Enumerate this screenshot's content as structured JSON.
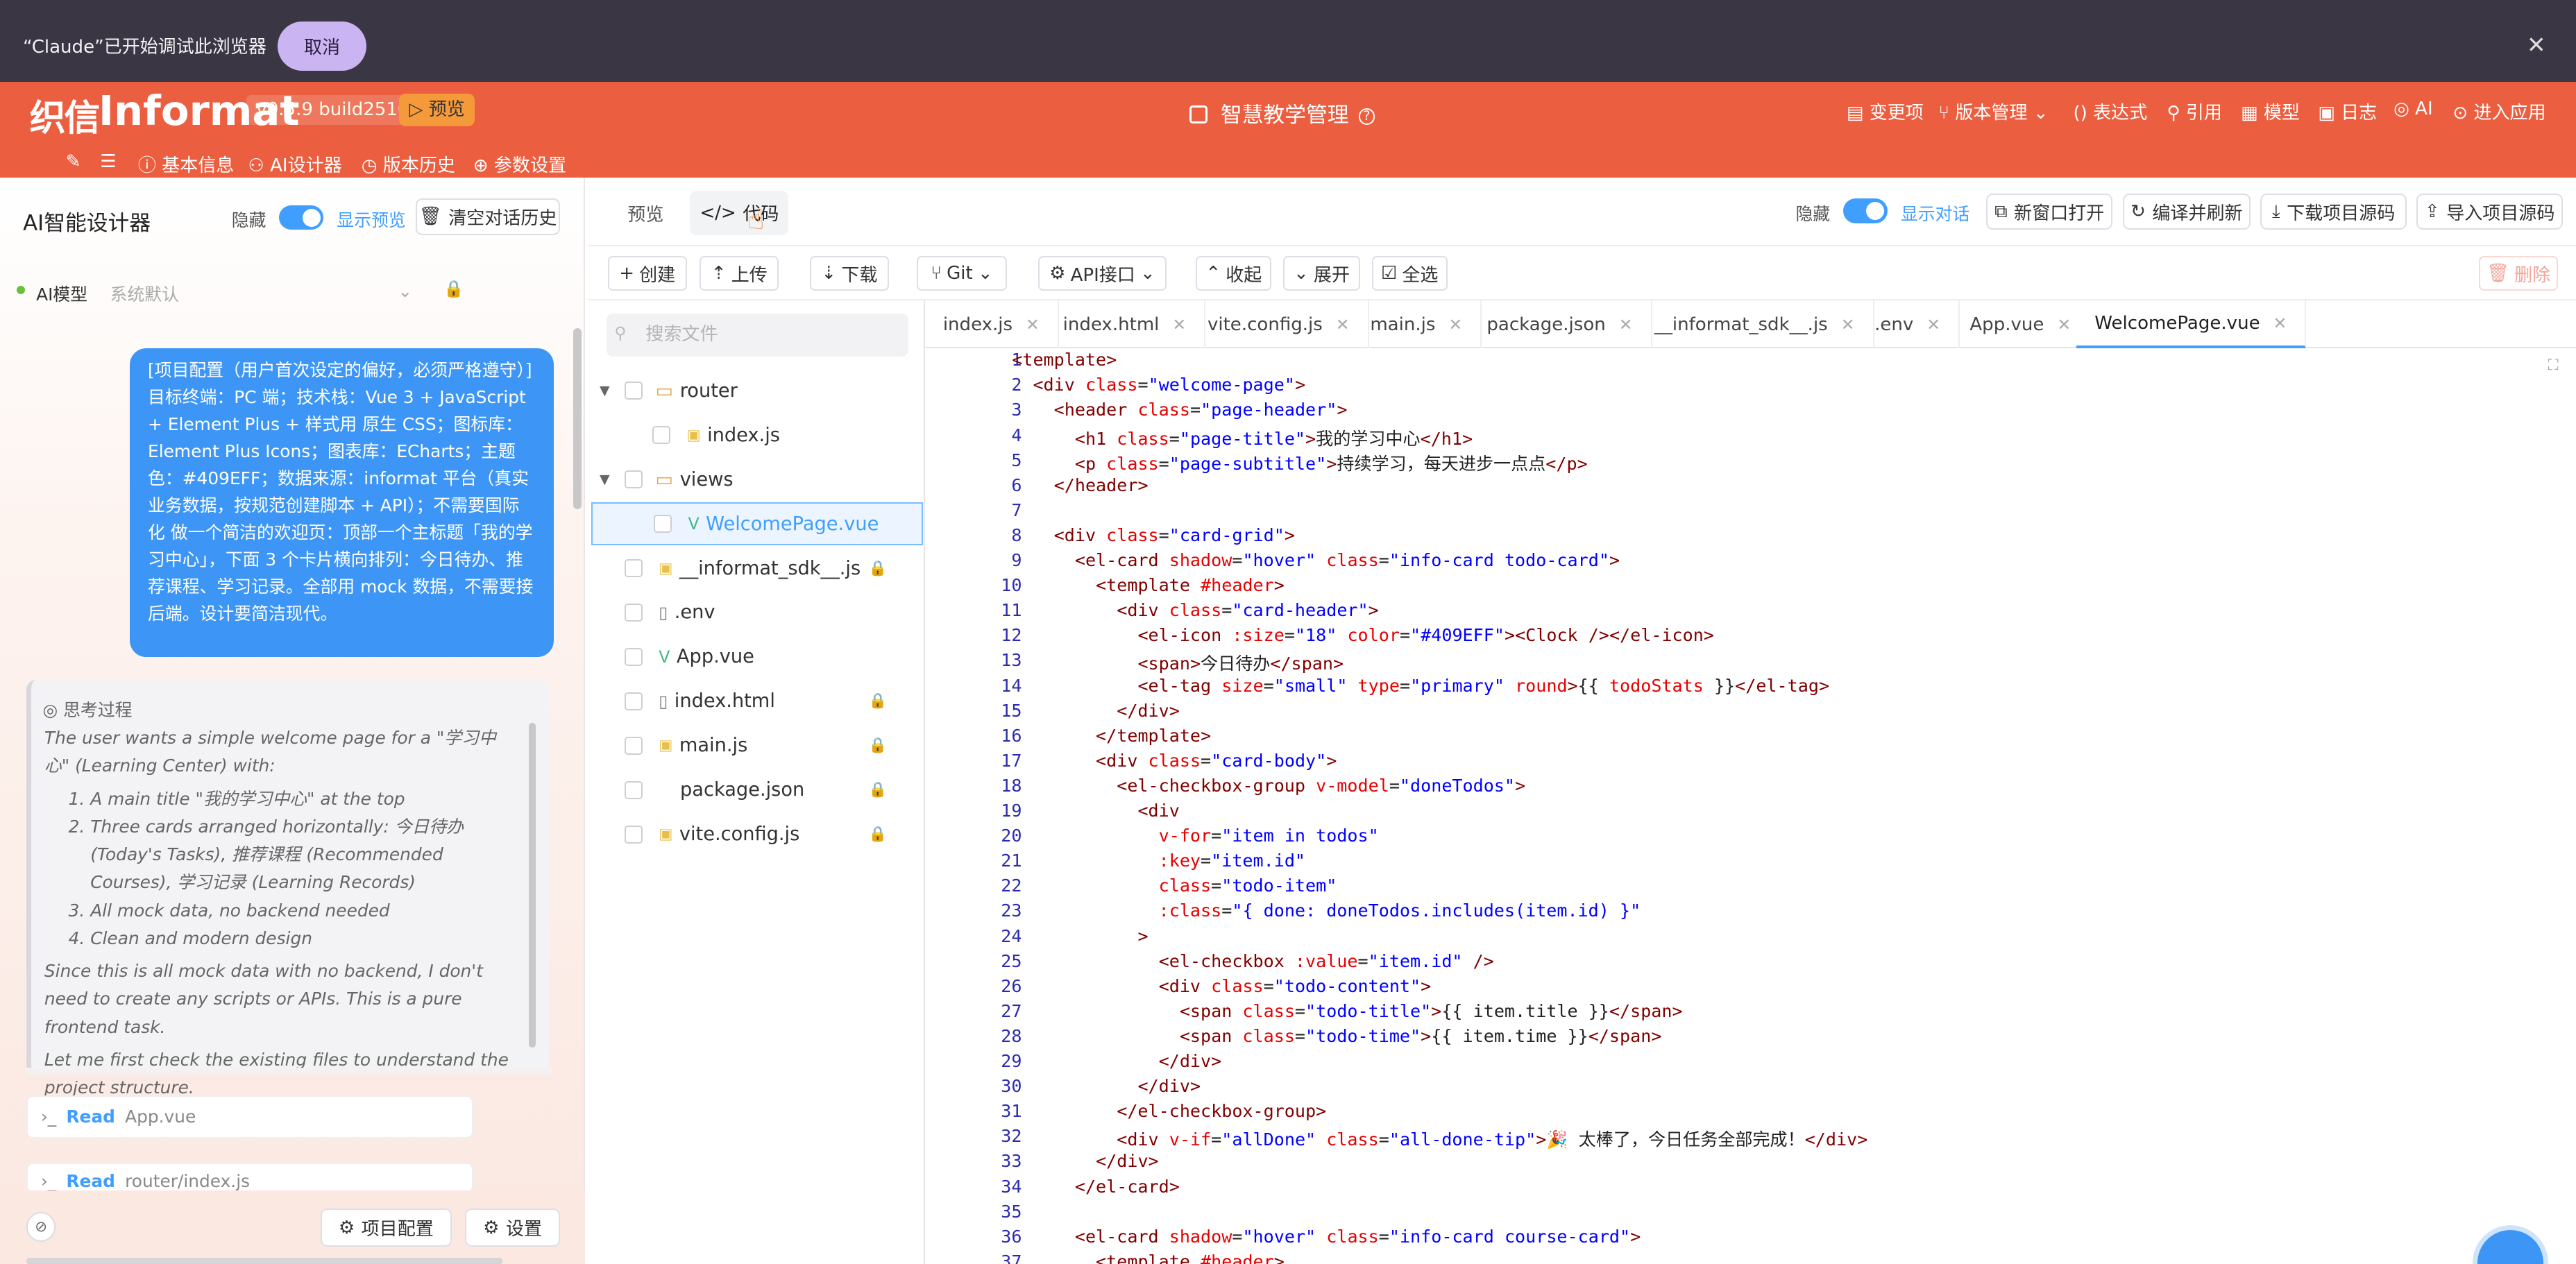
{
  "banner": {
    "text": "“Claude”已开始调试此浏览器",
    "cancel": "取消",
    "close": "✕"
  },
  "header": {
    "logo_mark": "织信",
    "logo_text": "Informat",
    "version": "v0.5.9 build2510",
    "preview_tag": "▷ 预览",
    "app_title": "智慧教学管理",
    "menu": [
      "变更项",
      "版本管理",
      "表达式",
      "引用",
      "模型",
      "日志",
      "AI",
      "进入应用"
    ],
    "subnav": [
      "基本信息",
      "AI设计器",
      "版本历史",
      "参数设置"
    ]
  },
  "left": {
    "title": "AI智能设计器",
    "hide": "隐藏",
    "show_preview": "显示预览",
    "clear": "清空对话历史",
    "model_label": "AI模型",
    "model_value": "系统默认",
    "user_message": "[项目配置（用户首次设定的偏好，必须严格遵守）] 目标终端：PC 端；技术栈：Vue 3 + JavaScript + Element Plus + 样式用 原生 CSS；图标库：Element Plus Icons；图表库：ECharts；主题色：#409EFF；数据来源：informat 平台（真实业务数据，按规范创建脚本 + API）；不需要国际化 做一个简洁的欢迎页：顶部一个主标题「我的学习中心」，下面 3 个卡片横向排列：今日待办、推荐课程、学习记录。全部用 mock 数据，不需要接后端。设计要简洁现代。",
    "think_title": "思考过程",
    "think_intro": "The user wants a simple welcome page for a \"学习中心\" (Learning Center) with:",
    "think_items": [
      "A main title \"我的学习中心\" at the top",
      "Three cards arranged horizontally: 今日待办 (Today's Tasks), 推荐课程 (Recommended Courses), 学习记录 (Learning Records)",
      "All mock data, no backend needed",
      "Clean and modern design"
    ],
    "think_p2": "Since this is all mock data with no backend, I don't need to create any scripts or APIs. This is a pure frontend task.",
    "think_p3": "Let me first check the existing files to understand the project structure.",
    "reads": [
      {
        "verb": "Read",
        "file": "App.vue"
      },
      {
        "verb": "Read",
        "file": "router/index.js"
      }
    ],
    "project_config": "项目配置",
    "settings": "设置"
  },
  "top_tabs": {
    "preview": "预览",
    "code": "代码",
    "hide": "隐藏",
    "show_dialog": "显示对话",
    "new_window": "新窗口打开",
    "compile": "编译并刷新",
    "download_src": "下载项目源码",
    "import_src": "导入项目源码"
  },
  "toolbar": {
    "create": "创建",
    "upload": "上传",
    "download": "下载",
    "git": "Git",
    "api": "API接口",
    "collapse": "收起",
    "expand": "展开",
    "select_all": "全选",
    "delete": "删除"
  },
  "filetree": {
    "search_placeholder": "搜索文件",
    "items": [
      {
        "name": "router",
        "type": "folder"
      },
      {
        "name": "index.js",
        "type": "js"
      },
      {
        "name": "views",
        "type": "folder"
      },
      {
        "name": "WelcomePage.vue",
        "type": "vue"
      },
      {
        "name": "__informat_sdk__.js",
        "type": "js"
      },
      {
        "name": ".env",
        "type": "file"
      },
      {
        "name": "App.vue",
        "type": "vue"
      },
      {
        "name": "index.html",
        "type": "file"
      },
      {
        "name": "main.js",
        "type": "js"
      },
      {
        "name": "package.json",
        "type": "file"
      },
      {
        "name": "vite.config.js",
        "type": "js"
      }
    ]
  },
  "file_tabs": [
    "index.js",
    "index.html",
    "vite.config.js",
    "main.js",
    "package.json",
    "__informat_sdk__.js",
    ".env",
    "App.vue",
    "WelcomePage.vue"
  ],
  "code_lines": [
    "<template>",
    "  <div class=\"welcome-page\">",
    "    <header class=\"page-header\">",
    "      <h1 class=\"page-title\">我的学习中心</h1>",
    "      <p class=\"page-subtitle\">持续学习，每天进步一点点</p>",
    "    </header>",
    "",
    "    <div class=\"card-grid\">",
    "      <el-card shadow=\"hover\" class=\"info-card todo-card\">",
    "        <template #header>",
    "          <div class=\"card-header\">",
    "            <el-icon :size=\"18\" color=\"#409EFF\"><Clock /></el-icon>",
    "            <span>今日待办</span>",
    "            <el-tag size=\"small\" type=\"primary\" round>{{ todoStats }}</el-tag>",
    "          </div>",
    "        </template>",
    "        <div class=\"card-body\">",
    "          <el-checkbox-group v-model=\"doneTodos\">",
    "            <div",
    "              v-for=\"item in todos\"",
    "              :key=\"item.id\"",
    "              class=\"todo-item\"",
    "              :class=\"{ done: doneTodos.includes(item.id) }\"",
    "            >",
    "              <el-checkbox :value=\"item.id\" />",
    "              <div class=\"todo-content\">",
    "                <span class=\"todo-title\">{{ item.title }}</span>",
    "                <span class=\"todo-time\">{{ item.time }}</span>",
    "              </div>",
    "            </div>",
    "          </el-checkbox-group>",
    "          <div v-if=\"allDone\" class=\"all-done-tip\">🎉 太棒了，今日任务全部完成！</div>",
    "        </div>",
    "      </el-card>",
    "",
    "      <el-card shadow=\"hover\" class=\"info-card course-card\">",
    "        <template #header>"
  ],
  "colors": {
    "header": "#ec5e40",
    "banner": "#3a3644",
    "accent": "#409eff",
    "user_bubble": "#3d96f5"
  }
}
